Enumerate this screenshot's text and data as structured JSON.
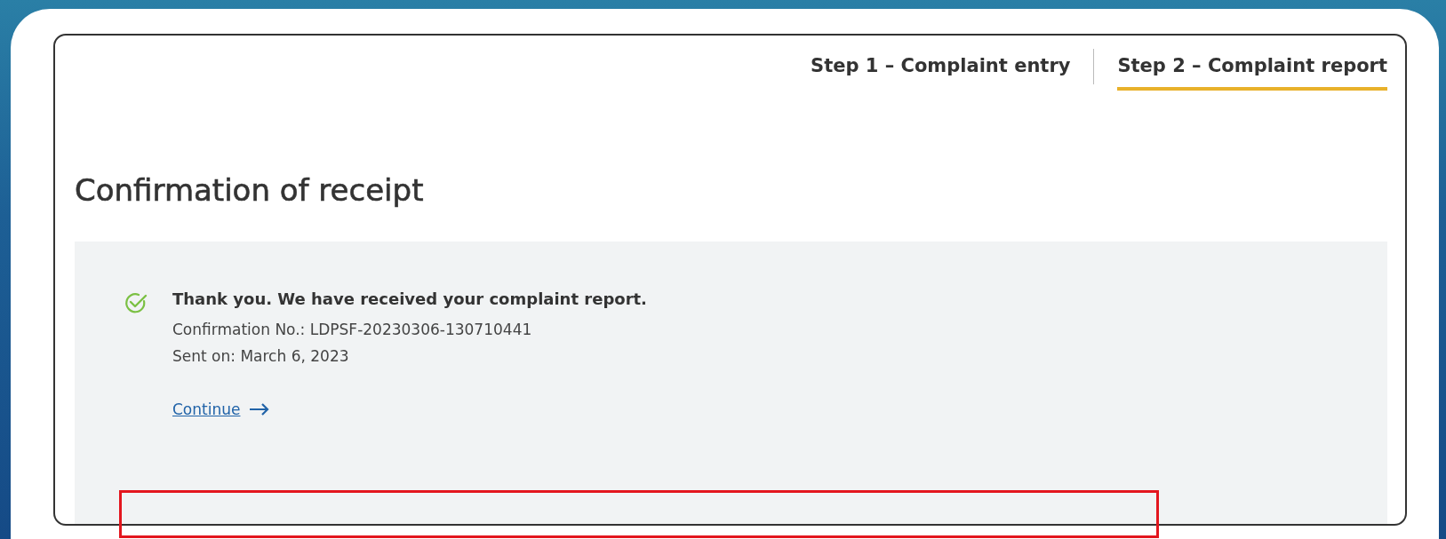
{
  "steps": [
    {
      "label": "Step 1 – Complaint entry",
      "selected": false
    },
    {
      "label": "Step 2 – Complaint report",
      "selected": true
    }
  ],
  "title": "Confirmation of receipt",
  "confirmation": {
    "message": "Thank you. We have received your complaint report.",
    "details": [
      "Confirmation No.: LDPSF-20230306-130710441",
      "Sent on: March 6, 2023"
    ],
    "link": "Continue"
  }
}
